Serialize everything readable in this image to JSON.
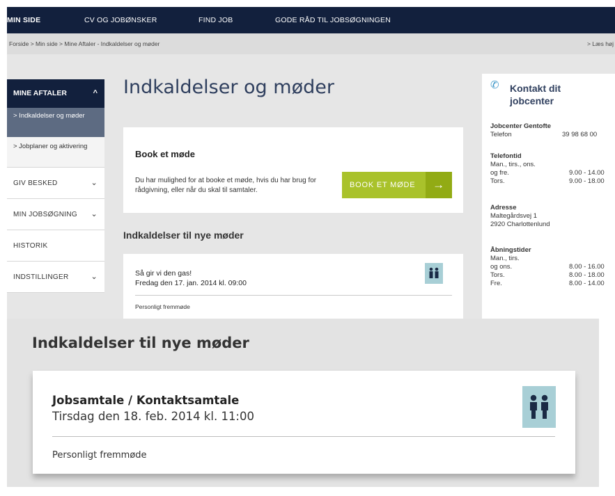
{
  "nav": {
    "items": [
      "MIN SIDE",
      "CV OG JOBØNSKER",
      "FIND JOB",
      "GODE RÅD TIL JOBSØGNINGEN"
    ]
  },
  "breadcrumb": {
    "path": "Forside > Min side > Mine Aftaler - Indkaldelser og møder",
    "read_aloud": "> Læs høj"
  },
  "sidebar": {
    "header": "MINE AFTALER",
    "header_chevron": "^",
    "sub_active": "> Indkaldelser og møder",
    "sub_item": "> Jobplaner og aktivering",
    "items": [
      "GIV BESKED",
      "MIN JOBSØGNING",
      "HISTORIK",
      "INDSTILLINGER"
    ]
  },
  "main": {
    "title": "Indkaldelser og møder",
    "book": {
      "title": "Book et møde",
      "text": "Du har mulighed for at booke et møde, hvis du har brug for rådgivning, eller når du skal til samtaler.",
      "button": "BOOK ET MØDE",
      "button_arrow": "→"
    },
    "section_title": "Indkaldelser til nye møder",
    "meeting": {
      "title": "Så gir vi den gas!",
      "datetime": "Fredag den 17. jan. 2014 kl. 09:00",
      "type": "Personligt fremmøde",
      "icon": "people-icon"
    }
  },
  "contact": {
    "title": "Kontakt dit jobcenter",
    "icon": "phone-icon",
    "center_name": "Jobcenter Gentofte",
    "phone_label": "Telefon",
    "phone": "39 98 68 00",
    "hours_title": "Telefontid",
    "hours": [
      {
        "day": "Man., tirs., ons.",
        "time": ""
      },
      {
        "day": "og fre.",
        "time": "9.00 - 14.00"
      },
      {
        "day": "Tors.",
        "time": "9.00 - 18.00"
      }
    ],
    "address_title": "Adresse",
    "address_line1": "Maltegårdsvej 1",
    "address_line2": "2920 Charlottenlund",
    "open_title": "Åbningstider",
    "open": [
      {
        "day": "Man., tirs.",
        "time": ""
      },
      {
        "day": "og ons.",
        "time": "8.00 - 16.00"
      },
      {
        "day": "Tors.",
        "time": "8.00 - 18.00"
      },
      {
        "day": "Fre.",
        "time": "8.00 - 14.00"
      }
    ]
  },
  "zoom": {
    "title": "Indkaldelser til nye møder",
    "meeting_title": "Jobsamtale / Kontaktsamtale",
    "meeting_datetime": "Tirsdag den 18. feb. 2014 kl. 11:00",
    "meeting_type": "Personligt fremmøde",
    "icon": "people-icon"
  },
  "colors": {
    "nav_bg": "#12203d",
    "accent_green": "#a9c22b",
    "icon_bg": "#a8cfd6",
    "title_blue": "#2f3f5e"
  }
}
